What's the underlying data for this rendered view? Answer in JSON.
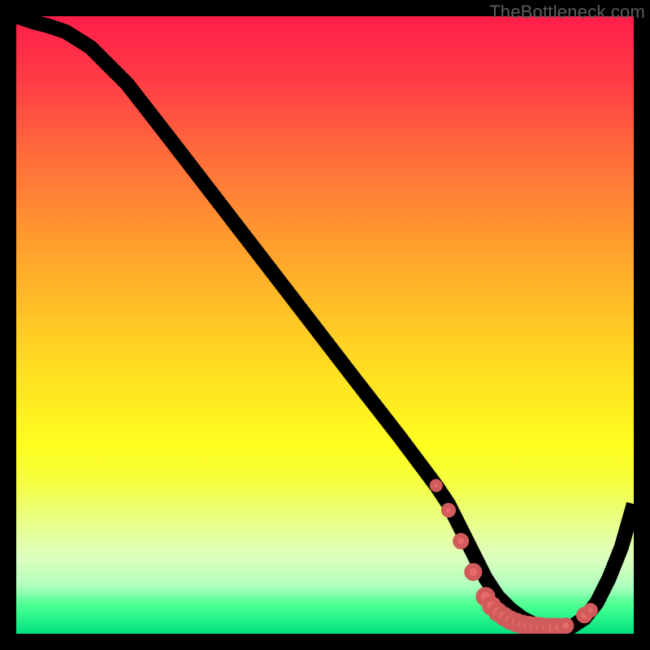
{
  "watermark": "TheBottleneck.com",
  "chart_data": {
    "type": "line",
    "title": "",
    "xlabel": "",
    "ylabel": "",
    "xlim": [
      0,
      100
    ],
    "ylim": [
      0,
      100
    ],
    "grid": false,
    "legend": false,
    "series": [
      {
        "name": "bottleneck-curve",
        "x": [
          0,
          3,
          5,
          8,
          12,
          18,
          25,
          35,
          45,
          55,
          62,
          65,
          68,
          70,
          72,
          74,
          76,
          78,
          80,
          82,
          84,
          86,
          88,
          90,
          92,
          94,
          96,
          98,
          100
        ],
        "y": [
          100,
          99,
          98.5,
          97.5,
          95,
          89,
          80,
          67,
          54,
          41,
          32,
          28,
          24,
          21,
          17,
          13,
          9,
          6,
          4,
          2.5,
          1.5,
          1,
          1,
          1.2,
          2.5,
          5,
          9,
          14,
          21
        ]
      }
    ],
    "optimal_points": {
      "name": "optimal-zone-dots",
      "x": [
        68,
        70,
        72,
        74,
        76,
        77,
        78,
        79,
        80,
        81,
        82,
        83,
        84,
        85,
        86,
        87,
        88,
        89,
        92,
        93
      ],
      "y": [
        24,
        20,
        15,
        10,
        6,
        4.5,
        3.5,
        2.8,
        2.2,
        1.8,
        1.5,
        1.3,
        1.2,
        1.1,
        1.0,
        1.0,
        1.1,
        1.3,
        3.0,
        3.8
      ]
    },
    "optimal_point_sizes": [
      5,
      6,
      7,
      8,
      9,
      9,
      9,
      9,
      9,
      9,
      9,
      9,
      9,
      9,
      9,
      9,
      8,
      7,
      7,
      6
    ]
  }
}
